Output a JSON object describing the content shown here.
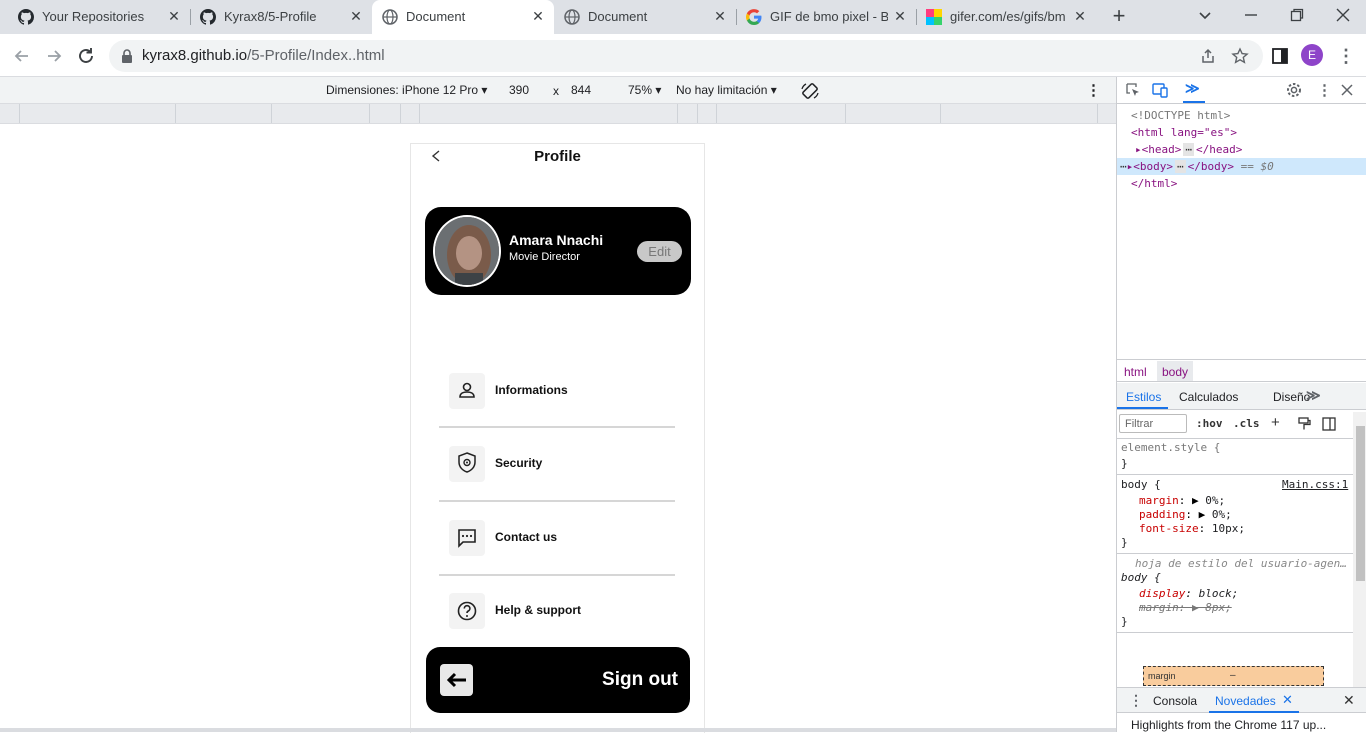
{
  "tabs": [
    {
      "title": "Your Repositories",
      "icon": "github-icon"
    },
    {
      "title": "Kyrax8/5-Profile",
      "icon": "github-icon"
    },
    {
      "title": "Document",
      "icon": "globe-icon",
      "active": true
    },
    {
      "title": "Document",
      "icon": "globe-icon"
    },
    {
      "title": "GIF de bmo pixel - Bu",
      "icon": "google-icon"
    },
    {
      "title": "gifer.com/es/gifs/bm",
      "icon": "gifer-icon"
    }
  ],
  "address": {
    "host": "kyrax8.github.io",
    "path": "/5-Profile/Index..html"
  },
  "profile_initial": "E",
  "device_toolbar": {
    "device": "Dimensiones: iPhone 12 Pro",
    "width": "390",
    "times": "x",
    "height": "844",
    "zoom": "75%",
    "throttle": "No hay limitación"
  },
  "app": {
    "title": "Profile",
    "user": {
      "name": "Amara Nnachi",
      "role": "Movie Director",
      "edit_label": "Edit"
    },
    "menu": [
      {
        "label": "Informations",
        "icon": "person-icon"
      },
      {
        "label": "Security",
        "icon": "shield-gear-icon"
      },
      {
        "label": "Contact us",
        "icon": "chat-icon"
      },
      {
        "label": "Help & support",
        "icon": "help-icon"
      }
    ],
    "signout_label": "Sign out"
  },
  "devtools": {
    "elements": [
      "<!DOCTYPE html>",
      "<html lang=\"es\">",
      "<head>",
      "</head>",
      "<body>",
      "</body>",
      "== $0",
      "</html>"
    ],
    "breadcrumbs": [
      "html",
      "body"
    ],
    "tabs": [
      "Estilos",
      "Calculados",
      "Diseño"
    ],
    "filter_placeholder": "Filtrar",
    "hov": ":hov",
    "cls": ".cls",
    "styles": {
      "element_style": "element.style {",
      "close": "}",
      "body_sel": "body {",
      "source": "Main.css:1",
      "decl1_prop": "margin",
      "decl1_val": "0%;",
      "decl2_prop": "padding",
      "decl2_val": "0%;",
      "decl3_prop": "font-size",
      "decl3_val": "10px;",
      "ua_comment": "hoja de estilo del usuario-agen…",
      "ua_body": "body {",
      "ua_decl1_prop": "display",
      "ua_decl1_val": "block;",
      "ua_decl2": "margin: ▶ 8px;",
      "box_margin": "margin",
      "box_dash": "–"
    },
    "drawer": {
      "tab1": "Consola",
      "tab2": "Novedades",
      "news": "Highlights from the Chrome 117 up..."
    }
  }
}
